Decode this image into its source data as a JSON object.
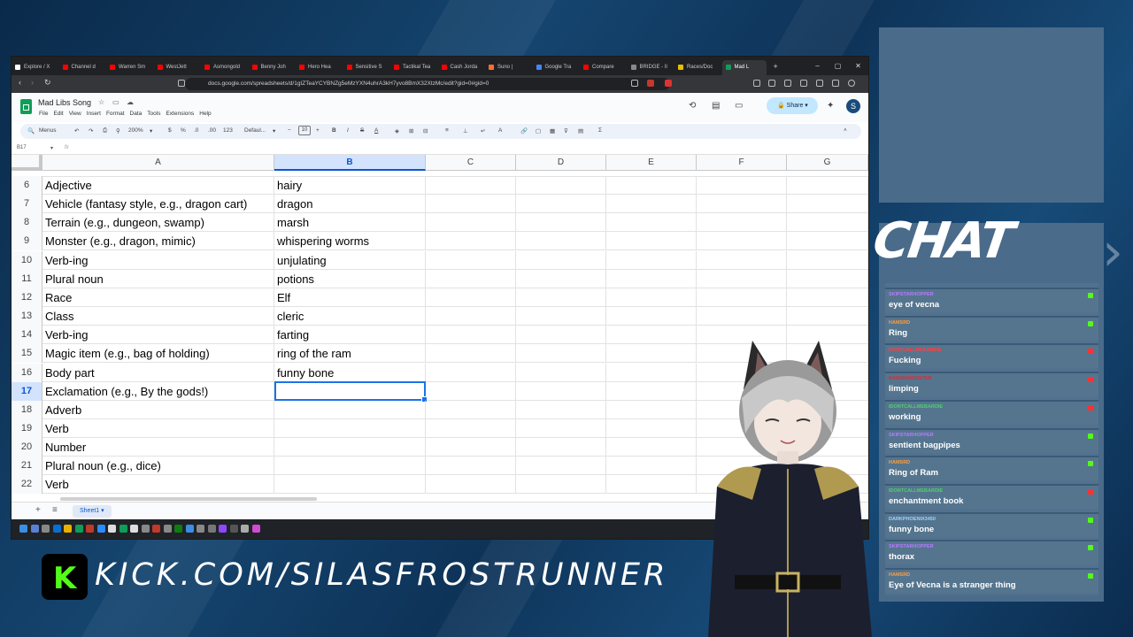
{
  "browser": {
    "tabs": [
      "Explore / X",
      "Channel d",
      "Warren Sm",
      "WestJett",
      "Asmongold",
      "Benny Joh",
      "Hero Hea",
      "Sensitive S",
      "Tactikal Tea",
      "Cash Jorda",
      "Suno |",
      "Google Tra",
      "Compare",
      "BRIDGE - Il",
      "Races/Doc",
      "Mad L"
    ],
    "url": "docs.google.com/spreadsheets/d/1gIZTeaYCYBNZg5eMzYXN4uhrA3kH7yvo8BmX32XtzMc/edit?gid=0#gid=0",
    "window_controls": [
      "–",
      "▢",
      "✕"
    ]
  },
  "sheet": {
    "title": "Mad Libs Song",
    "menus": [
      "File",
      "Edit",
      "View",
      "Insert",
      "Format",
      "Data",
      "Tools",
      "Extensions",
      "Help"
    ],
    "share_label": "Share",
    "avatar_letter": "S",
    "toolbar": {
      "menus_label": "Menus",
      "zoom": "200%",
      "currency": "$",
      "percent": "%",
      "dec_less": ".0",
      "dec_more": ".00",
      "number_format": "123",
      "font": "Defaul...",
      "font_size": "10",
      "bold": "B",
      "italic": "I",
      "strike": "S",
      "text_color": "A",
      "sum": "Σ"
    },
    "name_box": "B17",
    "fx": "fx",
    "columns": [
      "A",
      "B",
      "C",
      "D",
      "E",
      "F",
      "G"
    ],
    "selected_column": "B",
    "rows": [
      {
        "num": "6",
        "a": "Adjective",
        "b": "hairy"
      },
      {
        "num": "7",
        "a": "Vehicle (fantasy style, e.g., dragon cart)",
        "b": "dragon"
      },
      {
        "num": "8",
        "a": "Terrain (e.g., dungeon, swamp)",
        "b": "marsh"
      },
      {
        "num": "9",
        "a": "Monster (e.g., dragon, mimic)",
        "b": "whispering worms"
      },
      {
        "num": "10",
        "a": "Verb-ing",
        "b": "unjulating"
      },
      {
        "num": "11",
        "a": "Plural noun",
        "b": "potions"
      },
      {
        "num": "12",
        "a": "Race",
        "b": "Elf"
      },
      {
        "num": "13",
        "a": "Class",
        "b": "cleric"
      },
      {
        "num": "14",
        "a": "Verb-ing",
        "b": "farting"
      },
      {
        "num": "15",
        "a": "Magic item (e.g., bag of holding)",
        "b": "ring of the ram"
      },
      {
        "num": "16",
        "a": "Body part",
        "b": "funny bone"
      },
      {
        "num": "17",
        "a": "Exclamation (e.g., By the gods!)",
        "b": ""
      },
      {
        "num": "18",
        "a": "Adverb",
        "b": ""
      },
      {
        "num": "19",
        "a": "Verb",
        "b": ""
      },
      {
        "num": "20",
        "a": "Number",
        "b": ""
      },
      {
        "num": "21",
        "a": "Plural noun (e.g., dice)",
        "b": ""
      },
      {
        "num": "22",
        "a": "Verb",
        "b": ""
      }
    ],
    "sheet_tab": "Sheet1",
    "add_sheet": "+",
    "all_sheets": "≡"
  },
  "chat": {
    "title": "CHAT",
    "messages": [
      {
        "user": "SKIPSTARHOPPER",
        "text": "eye of vecna",
        "user_color": "#b57cff",
        "badge_color": "#53fc18"
      },
      {
        "user": "HAMSRD",
        "text": "Ring",
        "user_color": "#ff9d3b",
        "badge_color": "#53fc18"
      },
      {
        "user": "DONTCALLMEBARDIE",
        "text": "Fucking",
        "user_color": "#ff4040",
        "badge_color": "#ff3030"
      },
      {
        "user": "BARDIEMONSTER",
        "text": "limping",
        "user_color": "#d0303a",
        "badge_color": "#ff3030"
      },
      {
        "user": "IDONTCALLMEBARDIE",
        "text": "working",
        "user_color": "#4fcf6a",
        "badge_color": "#ff3030"
      },
      {
        "user": "SKIPSTARHOPPER",
        "text": "sentient bagpipes",
        "user_color": "#b57cff",
        "badge_color": "#53fc18"
      },
      {
        "user": "HAMSRD",
        "text": "Ring of Ram",
        "user_color": "#ff9d3b",
        "badge_color": "#53fc18"
      },
      {
        "user": "IDONTCALLMEBARDIE",
        "text": "enchantment book",
        "user_color": "#4fcf6a",
        "badge_color": "#ff3030"
      },
      {
        "user": "DARKPHOENIX3450",
        "text": "funny bone",
        "user_color": "#9fd3ff",
        "badge_color": "#53fc18"
      },
      {
        "user": "SKIPSTARHOPPER",
        "text": "thorax",
        "user_color": "#b57cff",
        "badge_color": "#53fc18"
      },
      {
        "user": "HAMSRD",
        "text": "Eye of Vecna is a stranger thing",
        "user_color": "#ff9d3b",
        "badge_color": "#53fc18"
      }
    ]
  },
  "footer": {
    "logo_letter": "K",
    "url_text": "KICK.COM/SILASFROSTRUNNER"
  }
}
